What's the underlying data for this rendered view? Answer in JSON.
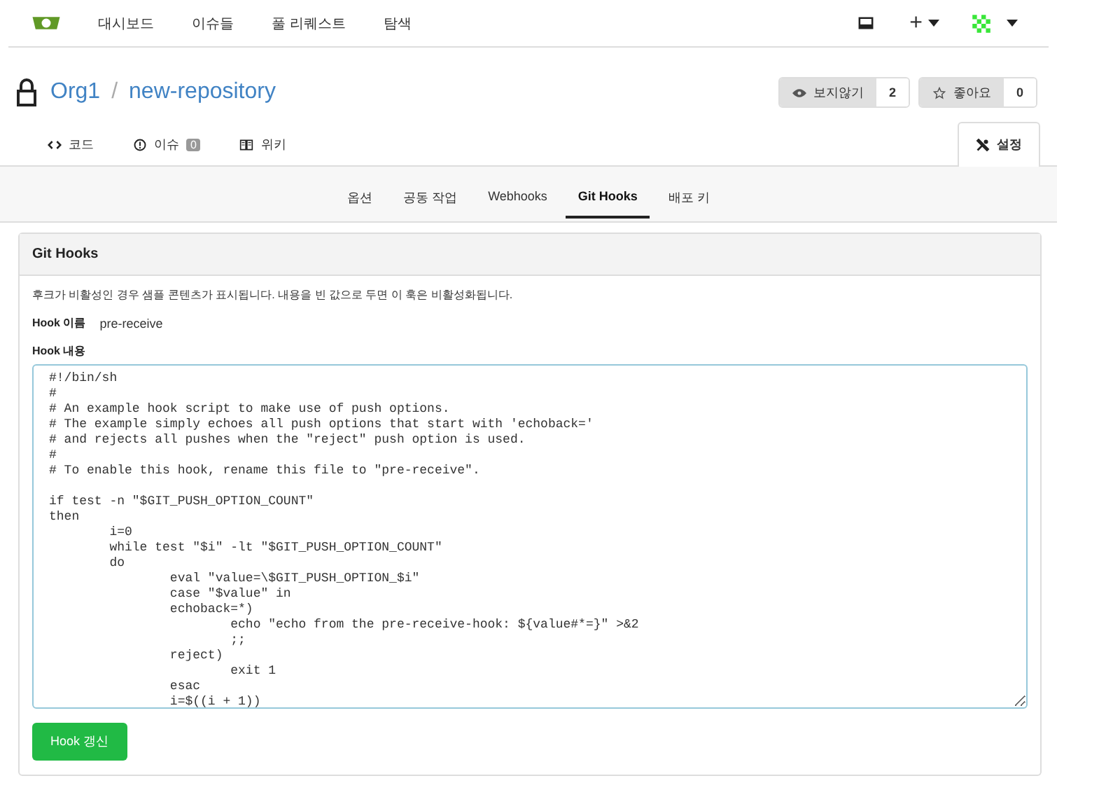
{
  "navbar": {
    "items": [
      {
        "label": "대시보드"
      },
      {
        "label": "이슈들"
      },
      {
        "label": "풀 리퀘스트"
      },
      {
        "label": "탐색"
      }
    ],
    "plus": "+"
  },
  "repo": {
    "owner": "Org1",
    "separator": "/",
    "name": "new-repository",
    "watch": {
      "label": "보지않기",
      "count": "2"
    },
    "star": {
      "label": "좋아요",
      "count": "0"
    }
  },
  "tabs": [
    {
      "label": "코드",
      "selected": false
    },
    {
      "label": "이슈",
      "badge": "0",
      "selected": false
    },
    {
      "label": "위키",
      "selected": false
    },
    {
      "label": "설정",
      "selected": true
    }
  ],
  "subtabs": [
    {
      "label": "옵션",
      "selected": false
    },
    {
      "label": "공동 작업",
      "selected": false
    },
    {
      "label": "Webhooks",
      "selected": false
    },
    {
      "label": "Git Hooks",
      "selected": true
    },
    {
      "label": "배포 키",
      "selected": false
    }
  ],
  "panel": {
    "title": "Git Hooks",
    "description": "후크가 비활성인 경우 샘플 콘텐츠가 표시됩니다. 내용을 빈 값으로 두면 이 훅은 비활성화됩니다.",
    "name_label": "Hook 이름",
    "name_value": "pre-receive",
    "content_label": "Hook 내용",
    "content": "#!/bin/sh\n#\n# An example hook script to make use of push options.\n# The example simply echoes all push options that start with 'echoback='\n# and rejects all pushes when the \"reject\" push option is used.\n#\n# To enable this hook, rename this file to \"pre-receive\".\n\nif test -n \"$GIT_PUSH_OPTION_COUNT\"\nthen\n        i=0\n        while test \"$i\" -lt \"$GIT_PUSH_OPTION_COUNT\"\n        do\n                eval \"value=\\$GIT_PUSH_OPTION_$i\"\n                case \"$value\" in\n                echoback=*)\n                        echo \"echo from the pre-receive-hook: ${value#*=}\" >&2\n                        ;;\n                reject)\n                        exit 1\n                esac\n                i=$((i + 1))",
    "button": "Hook 갱신"
  }
}
